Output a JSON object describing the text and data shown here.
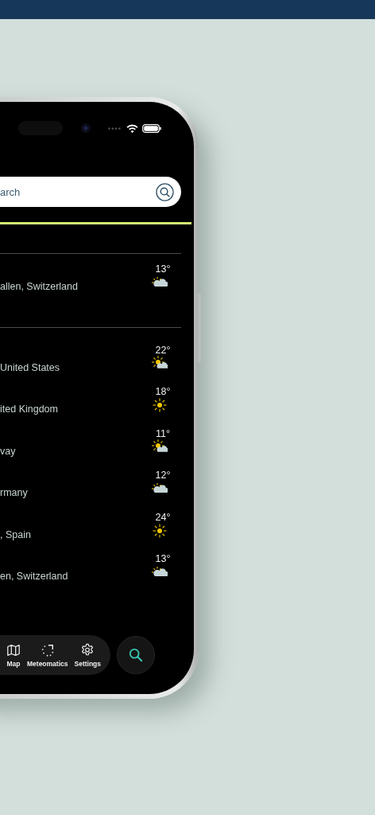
{
  "search": {
    "placeholder": "arch"
  },
  "sections": [
    {
      "locations": [
        {
          "name": "allen, Switzerland",
          "temperature": "13°",
          "kind": "cloud_sun"
        }
      ]
    },
    {
      "locations": [
        {
          "name": "United States",
          "temperature": "22°",
          "kind": "sun_cloud"
        },
        {
          "name": "ited Kingdom",
          "temperature": "18°",
          "kind": "sun"
        },
        {
          "name": "vay",
          "temperature": "11°",
          "kind": "sun_cloud"
        },
        {
          "name": "rmany",
          "temperature": "12°",
          "kind": "cloud_sun"
        },
        {
          "name": ", Spain",
          "temperature": "24°",
          "kind": "sun"
        },
        {
          "name": "en, Switzerland",
          "temperature": "13°",
          "kind": "cloud_sun"
        }
      ]
    }
  ],
  "nav": {
    "items": [
      {
        "label": "Map",
        "kind": "map"
      },
      {
        "label": "Meteomatics",
        "kind": "brand"
      },
      {
        "label": "Settings",
        "kind": "settings"
      }
    ]
  }
}
